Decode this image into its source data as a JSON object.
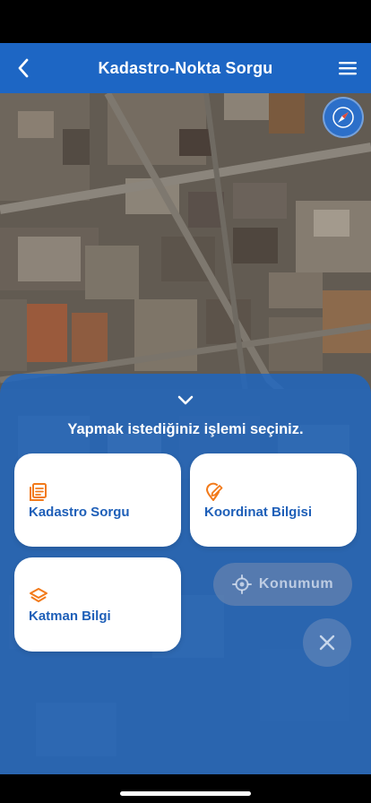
{
  "nav": {
    "title": "Kadastro-Nokta Sorgu",
    "back_icon": "chevron-left-icon",
    "menu_icon": "hamburger-menu-icon"
  },
  "map": {
    "compass_icon": "compass-icon"
  },
  "sheet": {
    "collapse_icon": "chevron-down-icon",
    "prompt": "Yapmak istediğiniz işlemi seçiniz.",
    "cards": [
      {
        "label": "Kadastro Sorgu",
        "icon": "document-list-icon"
      },
      {
        "label": "Koordinat Bilgisi",
        "icon": "location-edit-icon"
      },
      {
        "label": "Katman Bilgi",
        "icon": "layers-icon"
      }
    ]
  },
  "location_button": {
    "label": "Konumum",
    "icon": "crosshair-icon"
  },
  "close_button": {
    "icon": "close-icon"
  },
  "colors": {
    "primary": "#1d66c4",
    "accent": "#f27a1a",
    "card_text": "#1e5fb8"
  }
}
